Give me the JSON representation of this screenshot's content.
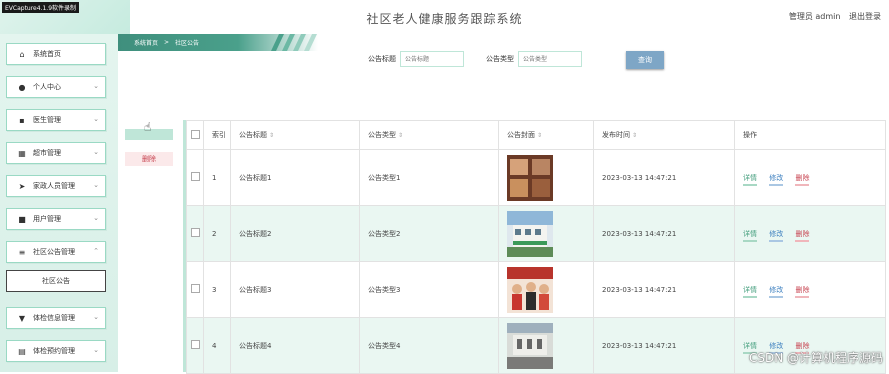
{
  "recorder": {
    "label": "EVCapture4.1.9软件录制"
  },
  "header": {
    "title": "社区老人健康服务跟踪系统",
    "user": "管理员 admin",
    "logout": "退出登录"
  },
  "sidebar": {
    "items": [
      {
        "label": "系统首页",
        "icon": "home-icon"
      },
      {
        "label": "个人中心",
        "icon": "user-icon"
      },
      {
        "label": "医生管理",
        "icon": "doctor-icon"
      },
      {
        "label": "超市管理",
        "icon": "grid-icon"
      },
      {
        "label": "家政人员管理",
        "icon": "send-icon"
      },
      {
        "label": "用户管理",
        "icon": "briefcase-icon"
      },
      {
        "label": "社区公告管理",
        "icon": "list-icon"
      },
      {
        "label": "体检信息管理",
        "icon": "cup-icon"
      },
      {
        "label": "体检预约管理",
        "icon": "calendar-icon"
      }
    ],
    "active_sub": "社区公告"
  },
  "breadcrumb": {
    "home": "系统首页",
    "separator": ">",
    "current": "社区公告"
  },
  "search": {
    "title_label": "公告标题",
    "title_placeholder": "公告标题",
    "type_label": "公告类型",
    "type_placeholder": "公告类型",
    "button": "查询"
  },
  "actions": {
    "delete": "删除"
  },
  "table": {
    "headers": {
      "index": "索引",
      "title": "公告标题",
      "type": "公告类型",
      "cover": "公告封面",
      "time": "发布时间",
      "ops": "操作"
    },
    "rows": [
      {
        "index": "1",
        "title": "公告标题1",
        "type": "公告类型1",
        "time": "2023-03-13 14:47:21"
      },
      {
        "index": "2",
        "title": "公告标题2",
        "type": "公告类型2",
        "time": "2023-03-13 14:47:21"
      },
      {
        "index": "3",
        "title": "公告标题3",
        "type": "公告类型3",
        "time": "2023-03-13 14:47:21"
      },
      {
        "index": "4",
        "title": "公告标题4",
        "type": "公告类型4",
        "time": "2023-03-13 14:47:21"
      }
    ],
    "ops": {
      "detail": "详情",
      "edit": "修改",
      "delete": "删除"
    }
  },
  "watermark": "CSDN @计算机程序源码",
  "colors": {
    "accent": "#3f8f7d",
    "sidebar_bg": "#e4f5ef",
    "delete": "#c7424f",
    "edit": "#3c7fbf",
    "detail": "#47a07f",
    "query_btn": "#7ea6c6"
  }
}
